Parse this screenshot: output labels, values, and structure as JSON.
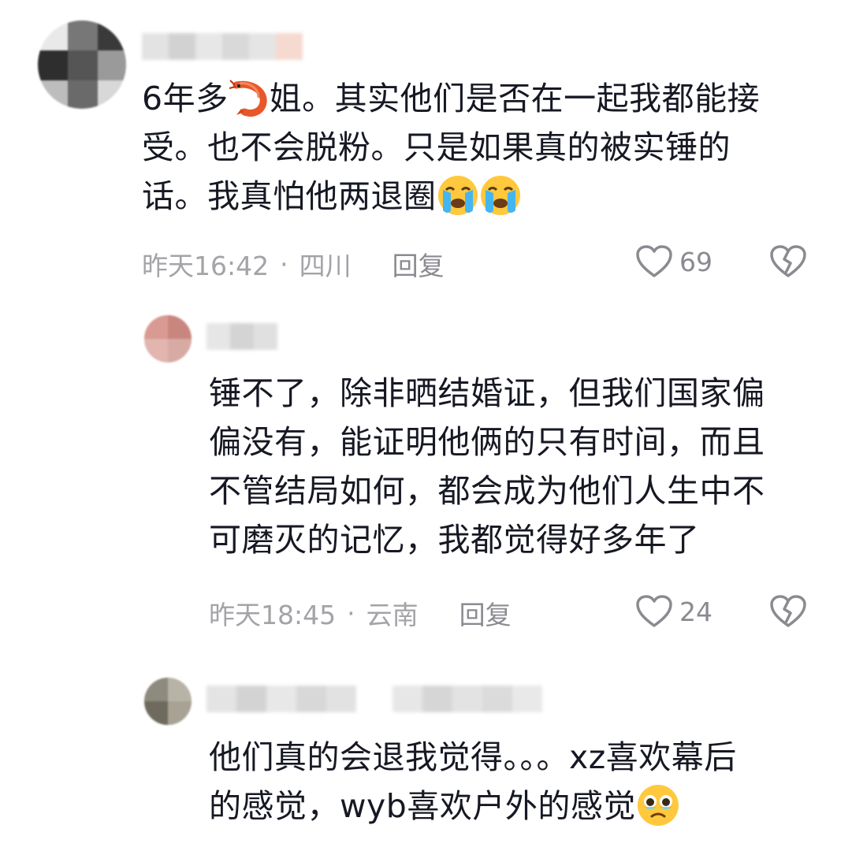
{
  "comments": [
    {
      "text_lines": [
        "6年多",
        "姐。其实他们是否在一起我都能接",
        "受。也不会脱粉。只是如果真的被实锤的",
        "话。我真怕他两退圈"
      ],
      "icon_shrimp": "shrimp-emoji",
      "icon_crying": "loudly-crying-face-emoji",
      "time": "昨天16:42",
      "separator": "·",
      "location": "四川",
      "reply_label": "回复",
      "likes": "69"
    },
    {
      "text_lines": [
        "锤不了，除非晒结婚证，但我们国家偏",
        "偏没有，能证明他俩的只有时间，而且",
        "不管结局如何，都会成为他们人生中不",
        "可磨灭的记忆，我都觉得好多年了"
      ],
      "time": "昨天18:45",
      "separator": "·",
      "location": "云南",
      "reply_label": "回复",
      "likes": "24"
    },
    {
      "text_lines": [
        "他们真的会退我觉得。。。xz喜欢幕后",
        "的感觉，wyb喜欢户外的感觉"
      ],
      "icon_face": "face-holding-back-tears-emoji"
    }
  ],
  "colors": {
    "text": "#161823",
    "meta": "#a3a3a8",
    "action": "#8a8b91"
  }
}
